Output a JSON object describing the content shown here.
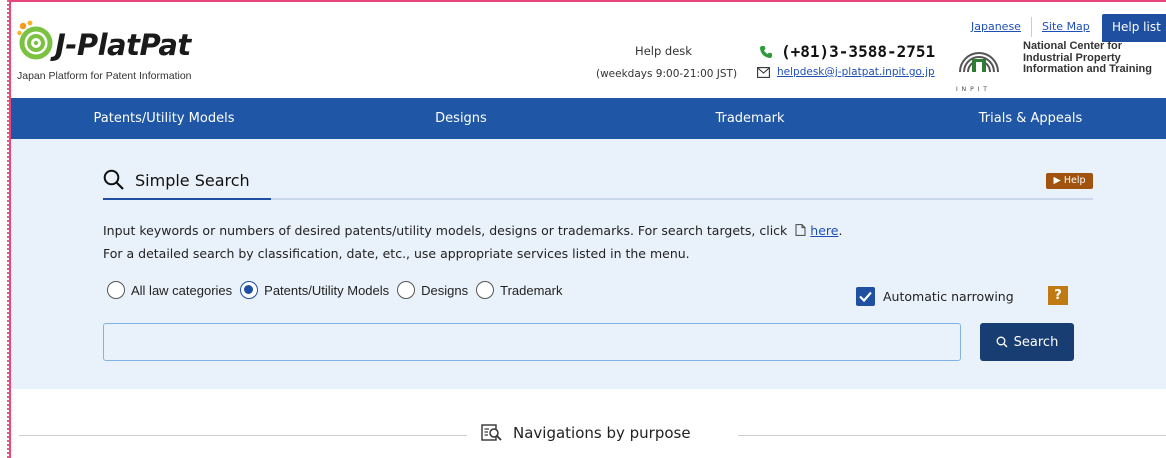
{
  "brand": {
    "name": "J-PlatPat",
    "tagline": "Japan Platform for Patent Information"
  },
  "helpdesk": {
    "title": "Help desk",
    "hours": "(weekdays 9:00-21:00 JST)",
    "phone": "(+81)3-3588-2751",
    "email": "helpdesk@j-platpat.inpit.go.jp"
  },
  "top_links": {
    "japanese": "Japanese",
    "site_map": "Site Map",
    "help_list": "Help list"
  },
  "inpit": {
    "letters": "I N P I T",
    "line1": "National Center for",
    "line2": "Industrial Property",
    "line3": "Information and Training"
  },
  "nav": {
    "items": [
      {
        "label": "Patents/Utility Models"
      },
      {
        "label": "Designs"
      },
      {
        "label": "Trademark"
      },
      {
        "label": "Trials & Appeals"
      }
    ]
  },
  "simple_search": {
    "title": "Simple Search",
    "help_label": "▶ Help",
    "desc_line1": "Input keywords or numbers of desired patents/utility models, designs or trademarks. For search targets, click",
    "desc_link": "here",
    "desc_line1_end": ".",
    "desc_line2": "For a detailed search by classification, date, etc., use appropriate services listed in the menu.",
    "radios": [
      {
        "label": "All law categories",
        "selected": false
      },
      {
        "label": "Patents/Utility Models",
        "selected": true
      },
      {
        "label": "Designs",
        "selected": false
      },
      {
        "label": "Trademark",
        "selected": false
      }
    ],
    "auto_narrowing": "Automatic narrowing",
    "auto_narrowing_checked": true,
    "qmark": "?",
    "input_value": "",
    "search_label": "Search"
  },
  "navigations": {
    "title": "Navigations by purpose"
  },
  "colors": {
    "nav_bg": "#1f56a5",
    "panel_bg": "#e9f2fa",
    "search_btn": "#173d72",
    "help_btn": "#a0520e",
    "accent_frame": "#e8467c"
  }
}
